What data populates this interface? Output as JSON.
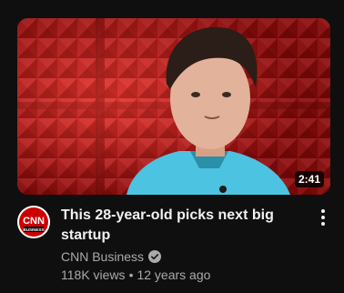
{
  "video": {
    "title": "This 28-year-old picks next big startup",
    "duration": "2:41",
    "views": "118K views",
    "age": "12 years ago"
  },
  "channel": {
    "name": "CNN Business",
    "logo_text": "CNN",
    "logo_subtext": "BUSINESS",
    "verified": true
  },
  "colors": {
    "background": "#0f0f0f",
    "title": "#f1f1f1",
    "secondary_text": "#aaaaaa",
    "cnn_red": "#cc0000",
    "thumbnail_red": "#c62020",
    "shirt": "#4cc3e0"
  },
  "icons": {
    "verified": "verified-check-icon",
    "menu": "more-vert-icon"
  }
}
